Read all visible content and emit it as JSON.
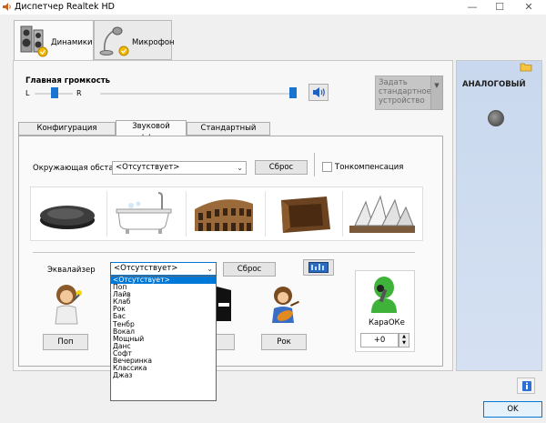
{
  "window": {
    "title": "Диспетчер Realtek HD",
    "controls": {
      "minimize": "—",
      "maximize": "☐",
      "close": "✕"
    }
  },
  "device_tabs": [
    {
      "label": "Динамики",
      "active": true,
      "icon": "speakers-icon"
    },
    {
      "label": "Микрофон",
      "active": false,
      "icon": "microphone-icon"
    }
  ],
  "volume": {
    "label": "Главная громкость",
    "left_label": "L",
    "right_label": "R",
    "balance_level": 0.5,
    "master_level": 1.0,
    "mute_icon": "speaker-volume-icon"
  },
  "default_device": {
    "label": "Задать стандартное устройство",
    "enabled": false
  },
  "inner_tabs": [
    {
      "label": "Конфигурация динамиков",
      "active": false
    },
    {
      "label": "Звуковой эффект",
      "active": true
    },
    {
      "label": "Стандартный формат",
      "active": false
    }
  ],
  "environment": {
    "label": "Окружающая обста...",
    "value": "<Отсутствует>",
    "reset_label": "Сброс",
    "loudness_label": "Тонкомпенсация",
    "loudness_checked": false,
    "presets": [
      "stone-icon",
      "bathtub-icon",
      "colosseum-icon",
      "box-room-icon",
      "opera-house-icon"
    ]
  },
  "equalizer": {
    "label": "Эквалайзер",
    "value": "<Отсутствует>",
    "reset_label": "Сброс",
    "graphic_eq_icon": "equalizer-panel-icon",
    "options": [
      "<Отсутствует>",
      "Поп",
      "Лайв",
      "Клаб",
      "Рок",
      "Бас",
      "Тенбр",
      "Вокал",
      "Мощный",
      "Данс",
      "Софт",
      "Вечеринка",
      "Классика",
      "Джаз"
    ],
    "selected_index": 0,
    "preset_buttons": [
      "Поп",
      "Лайв",
      "Клаб",
      "Рок"
    ],
    "partial_visible": [
      "б"
    ]
  },
  "karaoke": {
    "label": "КараОКе",
    "value": "+0"
  },
  "right_panel": {
    "connector_label": "АНАЛОГОВЫЙ",
    "folder_icon": "folder-icon",
    "jack_icon": "audio-jack-icon"
  },
  "footer": {
    "info_icon": "info-icon",
    "ok_label": "OK"
  },
  "colors": {
    "accent": "#0078d7",
    "slider": "#1874d0",
    "right_panel": "#c9d8ee"
  }
}
